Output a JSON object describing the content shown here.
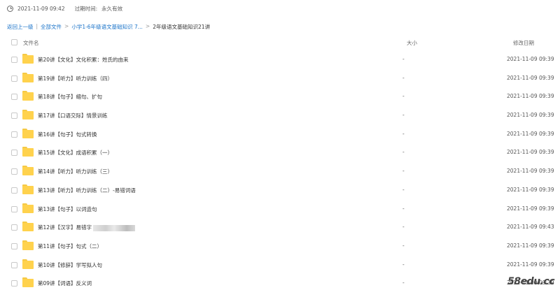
{
  "top": {
    "date": "2021-11-09 09:42",
    "expire_label": "过期时间:",
    "expire_value": "永久有效"
  },
  "breadcrumb": {
    "back": "返回上一级",
    "sep": "|",
    "all_files": "全部文件",
    "arrow": ">",
    "parent": "小学1-6年级语文基础知识 7...",
    "current": "2年级语文基础知识21讲"
  },
  "columns": {
    "name": "文件名",
    "size": "大小",
    "date": "修改日期"
  },
  "files": [
    {
      "name": "第20讲【文化】文化积累：姓氏的由来",
      "size": "-",
      "date": "2021-11-09 09:39"
    },
    {
      "name": "第19讲【听力】听力训练（四）",
      "size": "-",
      "date": "2021-11-09 09:39"
    },
    {
      "name": "第18讲【句子】缩句、扩句",
      "size": "-",
      "date": "2021-11-09 09:39"
    },
    {
      "name": "第17讲【口语交际】情景训练",
      "size": "-",
      "date": "2021-11-09 09:39"
    },
    {
      "name": "第16讲【句子】句式转换",
      "size": "-",
      "date": "2021-11-09 09:39"
    },
    {
      "name": "第15讲【文化】成语积累（一）",
      "size": "-",
      "date": "2021-11-09 09:39"
    },
    {
      "name": "第14讲【听力】听力训练（三）",
      "size": "-",
      "date": "2021-11-09 09:39"
    },
    {
      "name": "第13讲【听力】听力训练（二）-易错词语",
      "size": "-",
      "date": "2021-11-09 09:39"
    },
    {
      "name": "第13讲【句子】以词造句",
      "size": "-",
      "date": "2021-11-09 09:39"
    },
    {
      "name": "第12讲【汉字】易错字",
      "size": "-",
      "date": "2021-11-09 09:43"
    },
    {
      "name": "第11讲【句子】句式（二）",
      "size": "-",
      "date": "2021-11-09 09:39"
    },
    {
      "name": "第10讲【修辞】学写拟人句",
      "size": "-",
      "date": "2021-11-09 09:39"
    },
    {
      "name": "第09讲【词语】反义词",
      "size": "-",
      "date": "2021-11-09 09:39"
    }
  ],
  "watermark": "58edu.cc"
}
